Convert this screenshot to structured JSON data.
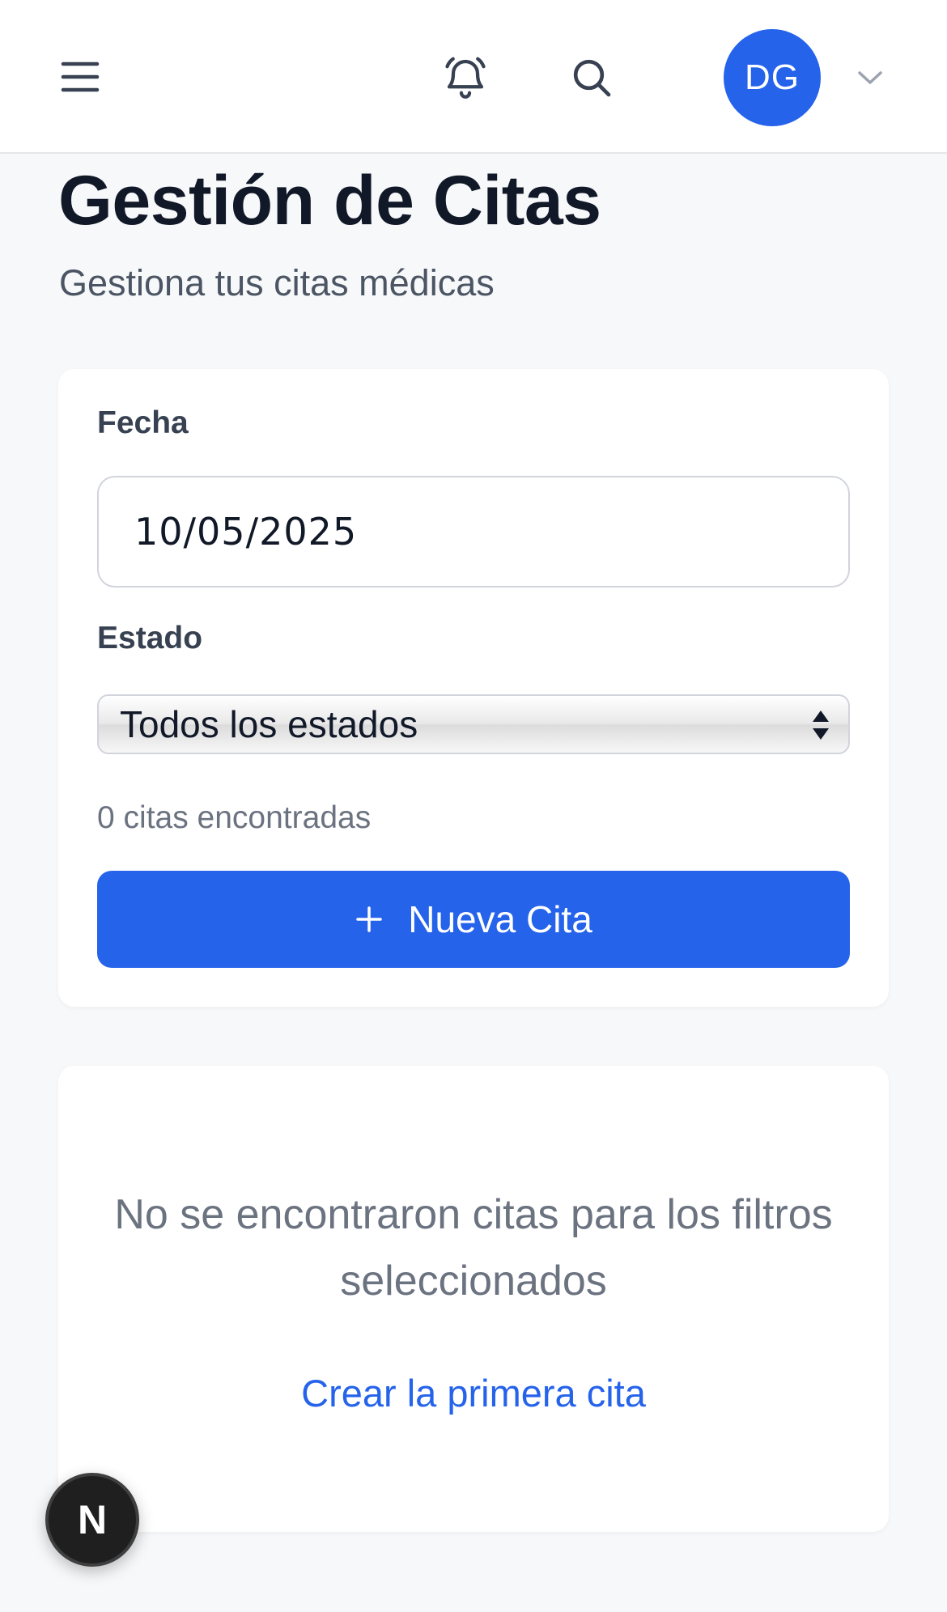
{
  "header": {
    "avatar_initials": "DG"
  },
  "page": {
    "title": "Gestión de Citas",
    "subtitle": "Gestiona tus citas médicas"
  },
  "filters": {
    "date_label": "Fecha",
    "date_value": "10/05/2025",
    "status_label": "Estado",
    "status_selected": "Todos los estados",
    "result_count": "0 citas encontradas",
    "new_button_label": "Nueva Cita"
  },
  "empty_state": {
    "message": "No se encontraron citas para los filtros seleccionados",
    "create_link": "Crear la primera cita"
  },
  "floating_badge": {
    "letter": "N"
  },
  "icons": {
    "menu": "menu-icon",
    "bell": "bell-icon",
    "search": "search-icon",
    "chevron": "chevron-down-icon",
    "plus": "plus-icon",
    "select_arrows": "select-arrows-icon"
  },
  "colors": {
    "accent": "#2563eb",
    "background": "#f7f8fa",
    "muted_text": "#6b7280"
  }
}
